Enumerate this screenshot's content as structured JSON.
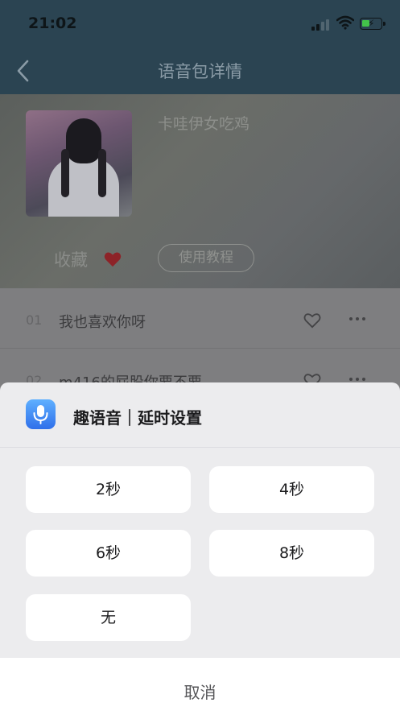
{
  "status_bar": {
    "time": "21:02"
  },
  "nav": {
    "title": "语音包详情"
  },
  "pack": {
    "name": "卡哇伊女吃鸡",
    "favorite_label": "收藏",
    "tutorial_label": "使用教程"
  },
  "tracks": [
    {
      "num": "01",
      "title": "我也喜欢你呀"
    },
    {
      "num": "02",
      "title": "m416的屁股你要不要"
    }
  ],
  "sheet": {
    "title": "趣语音｜延时设置",
    "options": [
      "2秒",
      "4秒",
      "6秒",
      "8秒",
      "无"
    ],
    "cancel_label": "取消"
  },
  "colors": {
    "accent_heart": "#b5262b",
    "app_icon": "#3a7ff0",
    "battery": "#43c24a"
  }
}
